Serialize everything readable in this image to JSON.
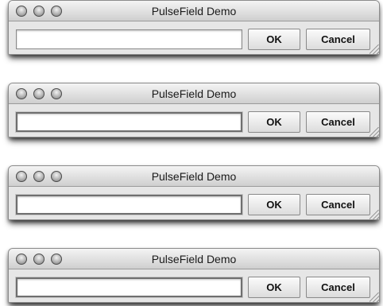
{
  "windows": [
    {
      "title": "PulseField Demo",
      "field_value": "",
      "ok_label": "OK",
      "cancel_label": "Cancel"
    },
    {
      "title": "PulseField Demo",
      "field_value": "",
      "ok_label": "OK",
      "cancel_label": "Cancel"
    },
    {
      "title": "PulseField Demo",
      "field_value": "",
      "ok_label": "OK",
      "cancel_label": "Cancel"
    },
    {
      "title": "PulseField Demo",
      "field_value": "",
      "ok_label": "OK",
      "cancel_label": "Cancel"
    }
  ],
  "icons": {
    "traffic_lights": [
      "close-icon",
      "minimize-icon",
      "zoom-icon"
    ],
    "resize": "resize-grip-icon"
  },
  "colors": {
    "window_bg": "#e9e9e9",
    "button_text": "#111111",
    "traffic_light": "#b3b3b3"
  }
}
